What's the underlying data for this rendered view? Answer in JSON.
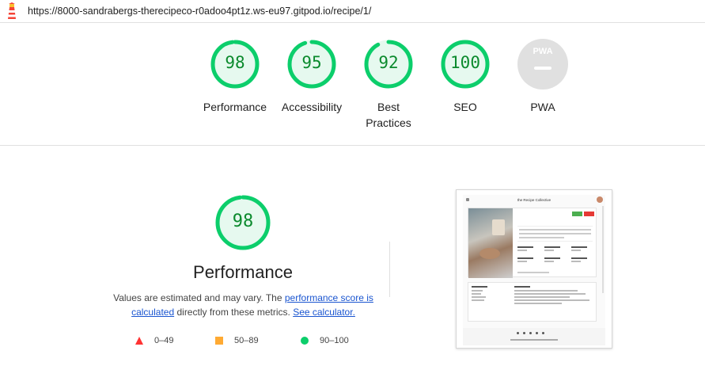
{
  "header": {
    "logo_icon": "lighthouse-icon",
    "url": "https://8000-sandrabergs-therecipeco-r0adoo4pt1z.ws-eu97.gitpod.io/recipe/1/"
  },
  "categories": [
    {
      "score": "98",
      "score_value": 98,
      "label": "Performance",
      "color": "#0cce6b"
    },
    {
      "score": "95",
      "score_value": 95,
      "label": "Accessibility",
      "color": "#0cce6b"
    },
    {
      "score": "92",
      "score_value": 92,
      "label": "Best Practices",
      "color": "#0cce6b"
    },
    {
      "score": "100",
      "score_value": 100,
      "label": "SEO",
      "color": "#0cce6b"
    },
    {
      "score": "PWA",
      "label": "PWA",
      "color": "#cccccc",
      "icon": "pwa-badge-icon"
    }
  ],
  "performance": {
    "score": "98",
    "score_value": 98,
    "title": "Performance",
    "desc_text_1": "Values are estimated and may vary. The ",
    "desc_link_1": "performance score is calculated",
    "desc_text_2": " directly from these metrics. ",
    "desc_link_2": "See calculator."
  },
  "legend": [
    {
      "range": "0–49",
      "icon": "fail-triangle-icon",
      "color": "#ff3333"
    },
    {
      "range": "50–89",
      "icon": "average-square-icon",
      "color": "#ffaa33"
    },
    {
      "range": "90–100",
      "icon": "pass-circle-icon",
      "color": "#0cce6b"
    }
  ],
  "screenshot": {
    "brand": "the Recipe Collective"
  },
  "colors": {
    "pass_green": "#0cce6b",
    "pass_text": "#0b8a2d",
    "pass_fill": "#e6f9ef",
    "link": "#1a55d0"
  }
}
